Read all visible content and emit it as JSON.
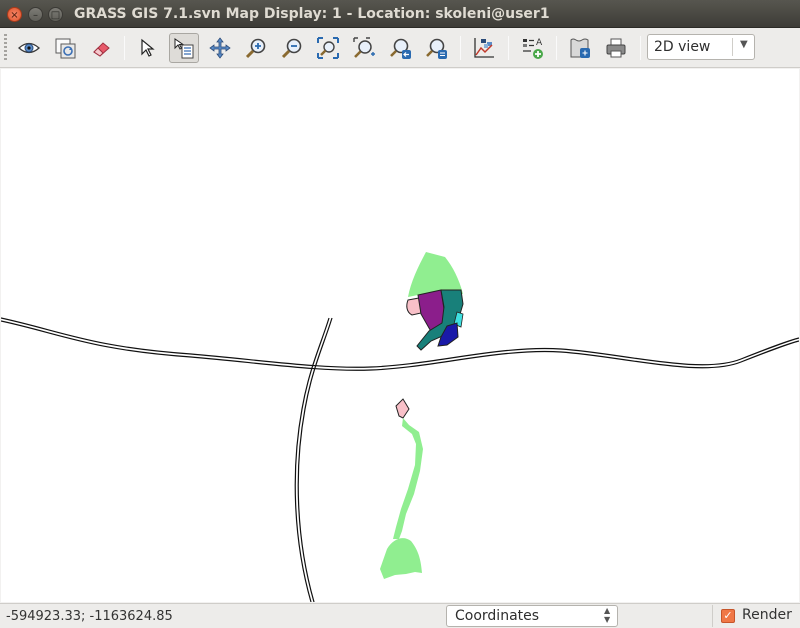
{
  "window": {
    "title": "GRASS GIS 7.1.svn Map Display: 1  - Location: skoleni@user1",
    "close_glyph": "×",
    "minimize_glyph": "–",
    "maximize_glyph": "□"
  },
  "toolbar": {
    "buttons": [
      {
        "name": "display-map-button",
        "icon": "eye-icon"
      },
      {
        "name": "render-map-button",
        "icon": "render-icon"
      },
      {
        "name": "erase-display-button",
        "icon": "eraser-icon"
      },
      {
        "name": "pointer-button",
        "icon": "pointer-icon"
      },
      {
        "name": "query-button",
        "icon": "query-icon",
        "active": true
      },
      {
        "name": "pan-button",
        "icon": "pan-icon"
      },
      {
        "name": "zoom-in-button",
        "icon": "zoom-in-icon"
      },
      {
        "name": "zoom-out-button",
        "icon": "zoom-out-icon"
      },
      {
        "name": "zoom-extent-button",
        "icon": "zoom-extent-icon"
      },
      {
        "name": "zoom-region-button",
        "icon": "zoom-region-icon"
      },
      {
        "name": "zoom-back-button",
        "icon": "zoom-back-icon"
      },
      {
        "name": "zoom-menu-button",
        "icon": "zoom-menu-icon"
      },
      {
        "name": "analyze-button",
        "icon": "analyze-icon"
      },
      {
        "name": "decoration-button",
        "icon": "legend-icon"
      },
      {
        "name": "save-button",
        "icon": "save-map-icon"
      },
      {
        "name": "print-button",
        "icon": "printer-icon"
      }
    ],
    "view_mode": "2D view"
  },
  "statusbar": {
    "coordinates": "-594923.33; -1163624.85",
    "mode": "Coordinates",
    "render_label": "Render",
    "render_checked": true
  },
  "colors": {
    "light_green": "#90ee90",
    "purple": "#8b1e8b",
    "teal": "#18807a",
    "cyan": "#3fe0e0",
    "blue": "#1a1aa8",
    "pink": "#f8c0c8",
    "road": "#111111"
  }
}
